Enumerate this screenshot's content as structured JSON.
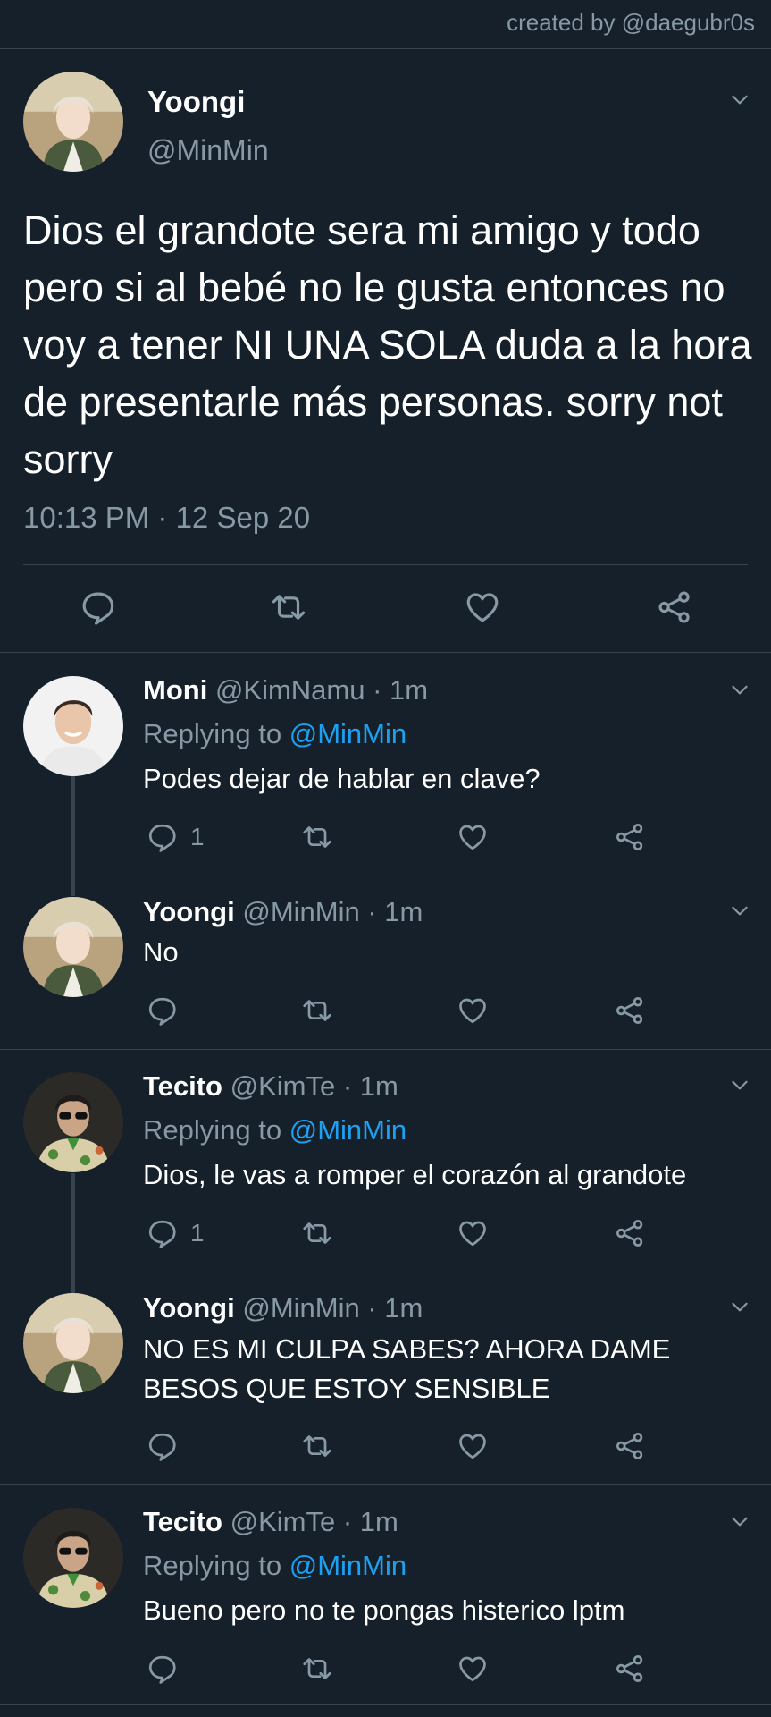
{
  "credit": "created by @daegubr0s",
  "main_tweet": {
    "name": "Yoongi",
    "handle": "@MinMin",
    "text": "Dios el grandote sera mi amigo y todo pero si al bebé no le gusta entonces no voy a tener NI UNA SOLA duda a la hora de presentarle más personas. sorry not sorry",
    "timestamp": "10:13 PM · 12 Sep 20"
  },
  "replies": [
    {
      "name": "Moni",
      "handle": "@KimNamu",
      "time": "· 1m",
      "replying_label": "Replying to",
      "replying_to": "@MinMin",
      "text": "Podes dejar de hablar en clave?",
      "reply_count": "1"
    },
    {
      "name": "Yoongi",
      "handle": "@MinMin",
      "time": "· 1m",
      "text": "No"
    },
    {
      "name": "Tecito",
      "handle": "@KimTe",
      "time": "· 1m",
      "replying_label": "Replying to",
      "replying_to": "@MinMin",
      "text": "Dios, le vas a romper el corazón al grandote",
      "reply_count": "1"
    },
    {
      "name": "Yoongi",
      "handle": "@MinMin",
      "time": "· 1m",
      "text": "NO ES MI CULPA SABES? AHORA DAME BESOS QUE ESTOY SENSIBLE"
    },
    {
      "name": "Tecito",
      "handle": "@KimTe",
      "time": "· 1m",
      "replying_label": "Replying to",
      "replying_to": "@MinMin",
      "text": "Bueno pero no te pongas histerico lptm"
    }
  ],
  "colors": {
    "background": "#15202b",
    "text": "#ffffff",
    "muted": "#8899a6",
    "link": "#1da1f2",
    "divider": "#38444d"
  },
  "icons": [
    "reply-icon",
    "retweet-icon",
    "like-icon",
    "share-icon",
    "chevron-down-icon"
  ]
}
